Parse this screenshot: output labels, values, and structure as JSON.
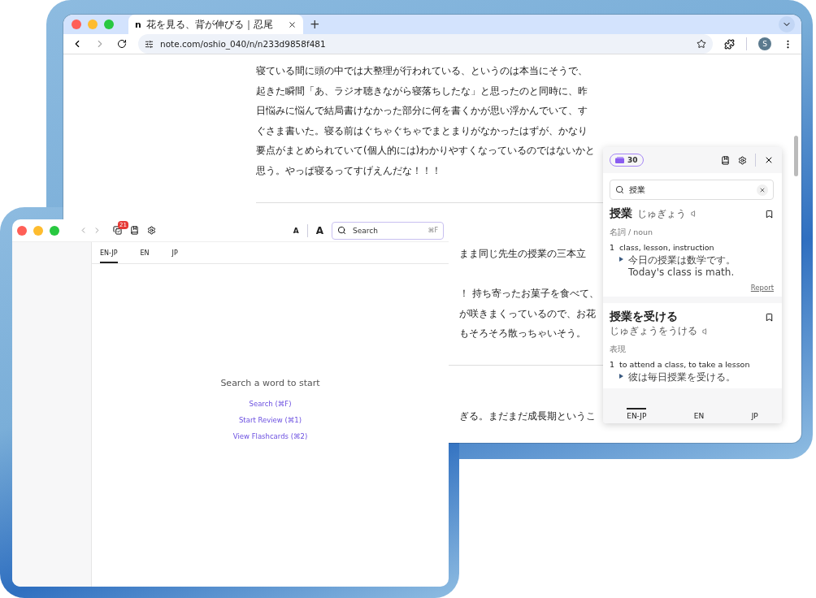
{
  "browser": {
    "tab": {
      "favicon": "n",
      "title": "花を見る、背が伸びる｜忍尾",
      "selected": true
    },
    "new_tab": "+",
    "forward": {
      "disabled": true
    },
    "url": "note.com/oshio_040/n/n233d9858f481",
    "profile_initial": "S"
  },
  "article": {
    "lines": [
      "寝ている間に頭の中では大整理が行われている、というのは本当にそうで、",
      "起きた瞬間「あ、ラジオ聴きながら寝落ちしたな」と思ったのと同時に、昨",
      "日悩みに悩んで結局書けなかった部分に何を書くかが思い浮かんでいて、す",
      "ぐさま書いた。寝る前はぐちゃぐちゃでまとまりがなかったはずが、かなり",
      "要点がまとめられていて(個人的には)わかりやすくなっているのではないかと",
      "思う。やっぱ寝るってすげえんだな！！！"
    ],
    "sections": [
      {
        "paragraphs": [
          [
            "まま同じ先生の授業の三本立"
          ],
          [
            "！ 持ち寄ったお菓子を食べて、",
            "が咲きまくっているので、お花",
            "もそろそろ散っちゃいそう。"
          ]
        ]
      },
      {
        "paragraphs": [
          [
            "ぎる。まだまだ成長期というこ"
          ]
        ]
      }
    ]
  },
  "lookup": {
    "count": "30",
    "query": "授業",
    "entries": [
      {
        "headword": "授業",
        "reading": "じゅぎょう",
        "pos": "名詞 / noun",
        "senses": [
          {
            "number": "1",
            "gloss": "class, lesson, instruction",
            "example": "今日の授業は数学です。",
            "translation": "Today's class is math."
          }
        ],
        "report": "Report"
      },
      {
        "headword": "授業を受ける",
        "reading": "じゅぎょうをうける",
        "pos": "表現",
        "senses": [
          {
            "number": "1",
            "gloss": "to attend a class, to take a lesson",
            "example": "彼は毎日授業を受ける。"
          }
        ]
      }
    ],
    "tabs": [
      {
        "label": "EN-JP",
        "selected": true
      },
      {
        "label": "EN",
        "selected": false
      },
      {
        "label": "JP",
        "selected": false
      }
    ]
  },
  "app": {
    "review_count": "21",
    "font_small": "A",
    "font_large": "A",
    "search": {
      "placeholder": "Search",
      "shortcut": "⌘F"
    },
    "tabs": [
      {
        "label": "EN-JP",
        "selected": true
      },
      {
        "label": "EN",
        "selected": false
      },
      {
        "label": "JP",
        "selected": false
      }
    ],
    "empty": {
      "message": "Search a word to start",
      "links": [
        "Search (⌘F)",
        "Start Review (⌘1)",
        "View Flashcards (⌘2)"
      ]
    }
  }
}
